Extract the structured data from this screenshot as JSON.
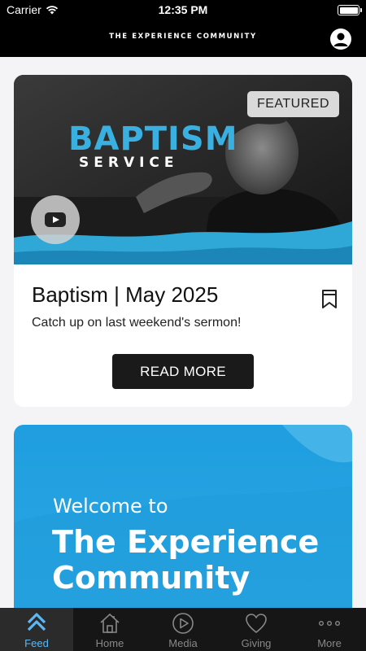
{
  "status_bar": {
    "carrier": "Carrier",
    "time": "12:35 PM",
    "wifi_icon": "wifi-icon",
    "battery_icon": "battery-icon"
  },
  "header": {
    "title": "THE EXPERIENCE COMMUNITY",
    "profile_icon": "profile-icon"
  },
  "featured_card": {
    "image_heading": "BAPTISM",
    "image_subheading": "SERVICE",
    "badge": "FEATURED",
    "play_icon": "youtube-play-icon",
    "title": "Baptism | May 2025",
    "subtitle": "Catch up on last weekend's sermon!",
    "bookmark_icon": "bookmark-icon",
    "button_label": "READ MORE"
  },
  "welcome_card": {
    "line1": "Welcome to",
    "line2": "The Experience",
    "line3": "Community"
  },
  "tabbar": {
    "tabs": [
      {
        "label": "Feed",
        "icon": "feed-chevrons-icon",
        "active": true
      },
      {
        "label": "Home",
        "icon": "home-icon",
        "active": false
      },
      {
        "label": "Media",
        "icon": "play-circle-icon",
        "active": false
      },
      {
        "label": "Giving",
        "icon": "heart-icon",
        "active": false
      },
      {
        "label": "More",
        "icon": "more-dots-icon",
        "active": false
      }
    ]
  },
  "colors": {
    "accent": "#5cb8f2",
    "brand_blue": "#2aa6e2",
    "header_bg": "#000000"
  }
}
